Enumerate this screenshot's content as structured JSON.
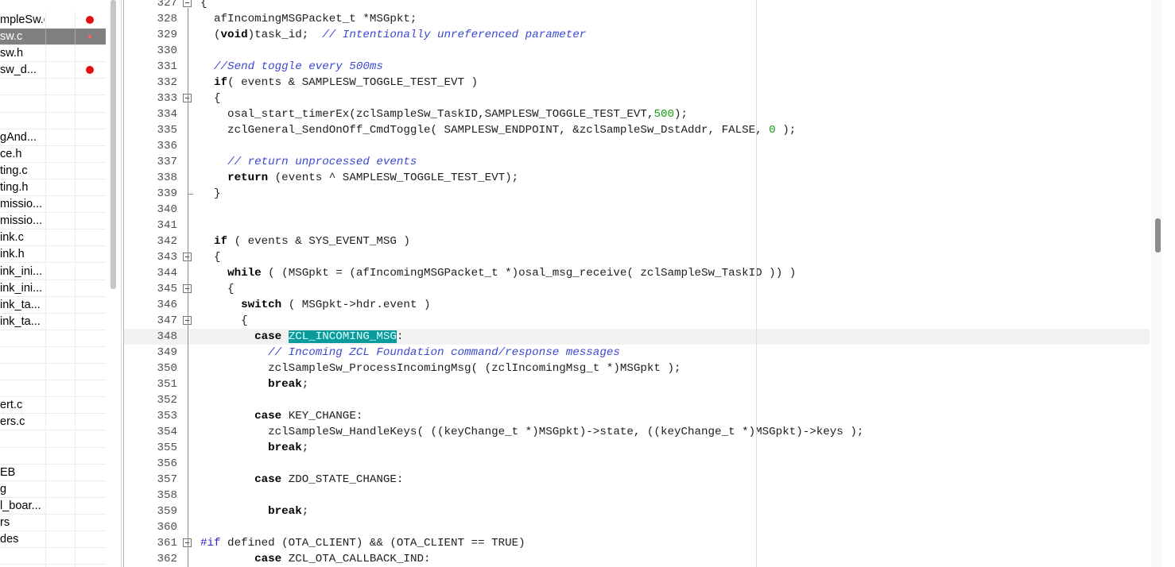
{
  "files": [
    {
      "name": "mpleSw.c",
      "dot": "red"
    },
    {
      "name": "sw.c",
      "dot": "small",
      "selected": true
    },
    {
      "name": "sw.h",
      "dot": ""
    },
    {
      "name": "sw_d...",
      "dot": "red"
    },
    {
      "name": "",
      "dot": ""
    },
    {
      "name": "",
      "dot": ""
    },
    {
      "name": "",
      "dot": ""
    },
    {
      "name": "gAnd...",
      "dot": ""
    },
    {
      "name": "ce.h",
      "dot": ""
    },
    {
      "name": "ting.c",
      "dot": ""
    },
    {
      "name": "ting.h",
      "dot": ""
    },
    {
      "name": "missio...",
      "dot": ""
    },
    {
      "name": "missio...",
      "dot": ""
    },
    {
      "name": "ink.c",
      "dot": ""
    },
    {
      "name": "ink.h",
      "dot": ""
    },
    {
      "name": "ink_ini...",
      "dot": ""
    },
    {
      "name": "ink_ini...",
      "dot": ""
    },
    {
      "name": "ink_ta...",
      "dot": ""
    },
    {
      "name": "ink_ta...",
      "dot": ""
    },
    {
      "name": "",
      "dot": ""
    },
    {
      "name": "",
      "dot": ""
    },
    {
      "name": "",
      "dot": ""
    },
    {
      "name": "",
      "dot": ""
    },
    {
      "name": "ert.c",
      "dot": ""
    },
    {
      "name": "ers.c",
      "dot": ""
    },
    {
      "name": "",
      "dot": ""
    },
    {
      "name": "",
      "dot": ""
    },
    {
      "name": "EB",
      "dot": ""
    },
    {
      "name": "g",
      "dot": ""
    },
    {
      "name": "l_boar...",
      "dot": ""
    },
    {
      "name": "rs",
      "dot": ""
    },
    {
      "name": "des",
      "dot": ""
    },
    {
      "name": "",
      "dot": ""
    },
    {
      "name": "",
      "dot": ""
    }
  ],
  "lines": [
    {
      "n": "327",
      "fold": "box",
      "t": [
        {
          "s": "{"
        }
      ]
    },
    {
      "n": "328",
      "t": [
        {
          "s": "  afIncomingMSGPacket_t *MSGpkt;"
        }
      ]
    },
    {
      "n": "329",
      "t": [
        {
          "s": "  ("
        },
        {
          "s": "void",
          "c": "k"
        },
        {
          "s": ")task_id;  "
        },
        {
          "s": "// Intentionally unreferenced parameter",
          "c": "c"
        }
      ]
    },
    {
      "n": "330",
      "t": []
    },
    {
      "n": "331",
      "t": [
        {
          "s": "  "
        },
        {
          "s": "//Send toggle every 500ms",
          "c": "c"
        }
      ]
    },
    {
      "n": "332",
      "t": [
        {
          "s": "  "
        },
        {
          "s": "if",
          "c": "k"
        },
        {
          "s": "( events & SAMPLESW_TOGGLE_TEST_EVT )"
        }
      ]
    },
    {
      "n": "333",
      "fold": "box",
      "t": [
        {
          "s": "  {"
        }
      ]
    },
    {
      "n": "334",
      "t": [
        {
          "s": "    osal_start_timerEx(zclSampleSw_TaskID,SAMPLESW_TOGGLE_TEST_EVT,"
        },
        {
          "s": "500",
          "c": "n"
        },
        {
          "s": ");"
        }
      ]
    },
    {
      "n": "335",
      "t": [
        {
          "s": "    zclGeneral_SendOnOff_CmdToggle( SAMPLESW_ENDPOINT, &zclSampleSw_DstAddr, FALSE, "
        },
        {
          "s": "0",
          "c": "n"
        },
        {
          "s": " );"
        }
      ]
    },
    {
      "n": "336",
      "t": []
    },
    {
      "n": "337",
      "t": [
        {
          "s": "    "
        },
        {
          "s": "// return unprocessed events",
          "c": "c"
        }
      ]
    },
    {
      "n": "338",
      "t": [
        {
          "s": "    "
        },
        {
          "s": "return",
          "c": "k"
        },
        {
          "s": " (events ^ SAMPLESW_TOGGLE_TEST_EVT);"
        }
      ]
    },
    {
      "n": "339",
      "fold": "end",
      "t": [
        {
          "s": "  }"
        }
      ]
    },
    {
      "n": "340",
      "t": []
    },
    {
      "n": "341",
      "t": []
    },
    {
      "n": "342",
      "t": [
        {
          "s": "  "
        },
        {
          "s": "if",
          "c": "k"
        },
        {
          "s": " ( events & SYS_EVENT_MSG )"
        }
      ]
    },
    {
      "n": "343",
      "fold": "box",
      "t": [
        {
          "s": "  {"
        }
      ]
    },
    {
      "n": "344",
      "t": [
        {
          "s": "    "
        },
        {
          "s": "while",
          "c": "k"
        },
        {
          "s": " ( (MSGpkt = (afIncomingMSGPacket_t *)osal_msg_receive( zclSampleSw_TaskID )) )"
        }
      ]
    },
    {
      "n": "345",
      "fold": "box",
      "t": [
        {
          "s": "    {"
        }
      ]
    },
    {
      "n": "346",
      "t": [
        {
          "s": "      "
        },
        {
          "s": "switch",
          "c": "k"
        },
        {
          "s": " ( MSGpkt->hdr.event )"
        }
      ]
    },
    {
      "n": "347",
      "fold": "box",
      "t": [
        {
          "s": "      {"
        }
      ]
    },
    {
      "n": "348",
      "current": true,
      "t": [
        {
          "s": "        "
        },
        {
          "s": "case",
          "c": "k"
        },
        {
          "s": " "
        },
        {
          "s": "ZCL_INCOMING_MSG",
          "c": "hl"
        },
        {
          "s": ":"
        }
      ]
    },
    {
      "n": "349",
      "t": [
        {
          "s": "          "
        },
        {
          "s": "// Incoming ZCL Foundation command/response messages",
          "c": "c"
        }
      ]
    },
    {
      "n": "350",
      "t": [
        {
          "s": "          zclSampleSw_ProcessIncomingMsg( (zclIncomingMsg_t *)MSGpkt );"
        }
      ]
    },
    {
      "n": "351",
      "t": [
        {
          "s": "          "
        },
        {
          "s": "break",
          "c": "k"
        },
        {
          "s": ";"
        }
      ]
    },
    {
      "n": "352",
      "t": []
    },
    {
      "n": "353",
      "t": [
        {
          "s": "        "
        },
        {
          "s": "case",
          "c": "k"
        },
        {
          "s": " KEY_CHANGE:"
        }
      ]
    },
    {
      "n": "354",
      "t": [
        {
          "s": "          zclSampleSw_HandleKeys( ((keyChange_t *)MSGpkt)->state, ((keyChange_t *)MSGpkt)->keys );"
        }
      ]
    },
    {
      "n": "355",
      "t": [
        {
          "s": "          "
        },
        {
          "s": "break",
          "c": "k"
        },
        {
          "s": ";"
        }
      ]
    },
    {
      "n": "356",
      "t": []
    },
    {
      "n": "357",
      "t": [
        {
          "s": "        "
        },
        {
          "s": "case",
          "c": "k"
        },
        {
          "s": " ZDO_STATE_CHANGE:"
        }
      ]
    },
    {
      "n": "358",
      "t": []
    },
    {
      "n": "359",
      "t": [
        {
          "s": "          "
        },
        {
          "s": "break",
          "c": "k"
        },
        {
          "s": ";"
        }
      ]
    },
    {
      "n": "360",
      "t": []
    },
    {
      "n": "361",
      "fold": "box",
      "t": [
        {
          "s": "#if",
          "c": "pp"
        },
        {
          "s": " defined (OTA_CLIENT) && (OTA_CLIENT == TRUE)"
        }
      ]
    },
    {
      "n": "362",
      "t": [
        {
          "s": "        "
        },
        {
          "s": "case",
          "c": "k"
        },
        {
          "s": " ZCL_OTA_CALLBACK_IND:"
        }
      ]
    }
  ]
}
